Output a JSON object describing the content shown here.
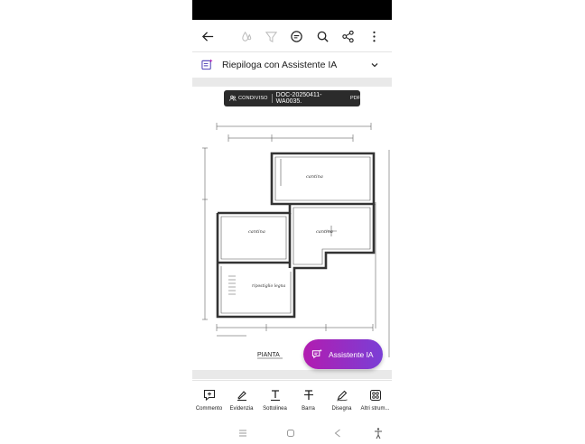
{
  "toolbar": {
    "back_icon": "arrow-left-icon",
    "icons": [
      "drop-icon",
      "filter-icon",
      "comment-bubble-icon",
      "search-icon",
      "share-icon",
      "more-vert-icon"
    ]
  },
  "ai_summary": {
    "label": "Riepiloga con Assistente IA",
    "icon": "ai-summary-icon"
  },
  "document": {
    "shared_label": "CONDIVISO",
    "filename": "DOC-20250411-WA0035.",
    "extension": "PDF",
    "floorplan_labels": {
      "cantina_top": "cantina",
      "cantina_left": "cantina",
      "cantina_right": "cantina",
      "ripostiglio": "ripostiglio legna",
      "pianta": "PIANTA"
    }
  },
  "fab": {
    "label": "Assistente IA",
    "accent": "#b21cb0"
  },
  "bottom_tools": [
    {
      "label": "Commento"
    },
    {
      "label": "Evidenzia"
    },
    {
      "label": "Sottolinea"
    },
    {
      "label": "Barra"
    },
    {
      "label": "Disegna"
    },
    {
      "label": "Altri strum..."
    }
  ]
}
